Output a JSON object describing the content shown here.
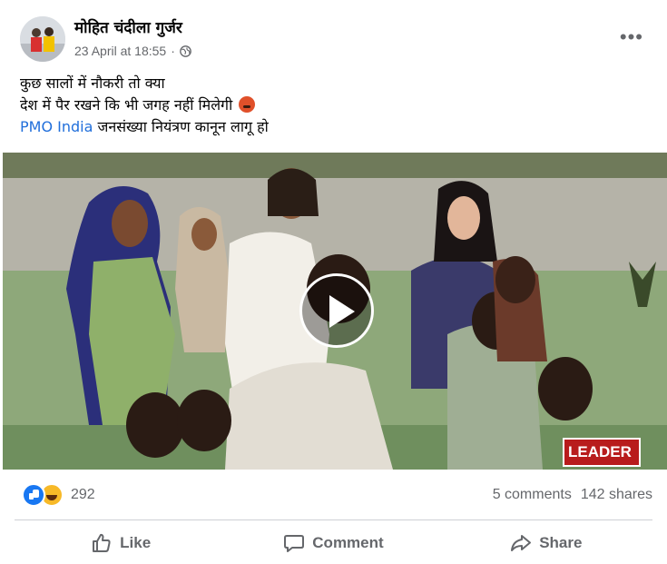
{
  "post": {
    "author": "मोहित चंदीला गुर्जर",
    "timestamp": "23 April at 18:55",
    "audience_icon": "globe-icon",
    "menu_icon": "more-icon",
    "text_line1": "कुछ सालों में नौकरी तो क्या",
    "text_line2": "देश में पैर रखने कि भी जगह नहीं मिलेगी",
    "text_line2_emoji": "angry-face-icon",
    "mention": "PMO India",
    "text_line3": " जनसंख्या नियंत्रण कानून लागू हो"
  },
  "video": {
    "play_icon": "play-icon",
    "watermark": "LEADER"
  },
  "stats": {
    "reaction_icons": [
      "like-icon",
      "haha-icon"
    ],
    "reaction_count": "292",
    "comments": "5 comments",
    "shares": "142 shares"
  },
  "actions": {
    "like": "Like",
    "comment": "Comment",
    "share": "Share"
  },
  "colors": {
    "link": "#216fdb",
    "meta_text": "#65676b",
    "like_blue": "#1877f2"
  }
}
